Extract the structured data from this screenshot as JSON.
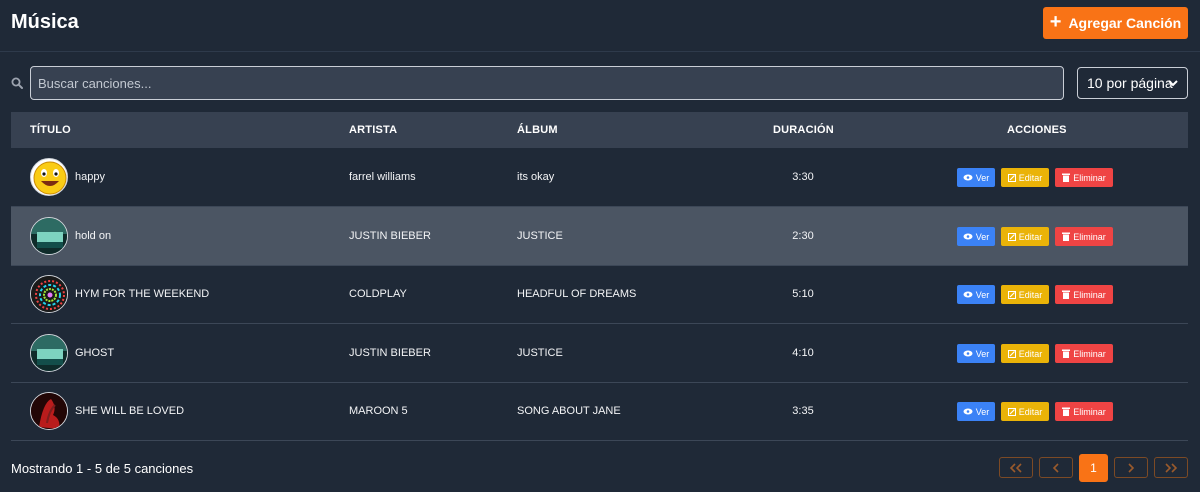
{
  "header": {
    "title": "Música",
    "add_button_label": "Agregar Canción"
  },
  "search": {
    "placeholder": "Buscar canciones...",
    "per_page": "10 por página"
  },
  "table": {
    "columns": [
      "TÍTULO",
      "ARTISTA",
      "ÁLBUM",
      "DURACIÓN",
      "ACCIONES"
    ],
    "rows": [
      {
        "title": "happy",
        "artist": "farrel williams",
        "album": "its okay",
        "duration": "3:30"
      },
      {
        "title": "hold on",
        "artist": "JUSTIN BIEBER",
        "album": "JUSTICE",
        "duration": "2:30"
      },
      {
        "title": "HYM FOR THE WEEKEND",
        "artist": "COLDPLAY",
        "album": "HEADFUL OF DREAMS",
        "duration": "5:10"
      },
      {
        "title": "GHOST",
        "artist": "JUSTIN BIEBER",
        "album": "JUSTICE",
        "duration": "4:10"
      },
      {
        "title": "SHE WILL BE LOVED",
        "artist": "MAROON 5",
        "album": "SONG ABOUT JANE",
        "duration": "3:35"
      }
    ],
    "actions": {
      "view": "Ver",
      "edit": "Editar",
      "delete": "Eliminar"
    }
  },
  "footer": {
    "summary": "Mostrando 1 - 5 de 5 canciones",
    "current_page": "1"
  },
  "colors": {
    "accent": "#f97316",
    "view": "#3b82f6",
    "edit": "#eab308",
    "delete": "#ef4444"
  },
  "icons": [
    "search-icon",
    "plus-icon",
    "chevron-down-icon",
    "eye-icon",
    "edit-icon",
    "trash-icon",
    "double-chevron-left-icon",
    "chevron-left-icon",
    "chevron-right-icon",
    "double-chevron-right-icon"
  ]
}
